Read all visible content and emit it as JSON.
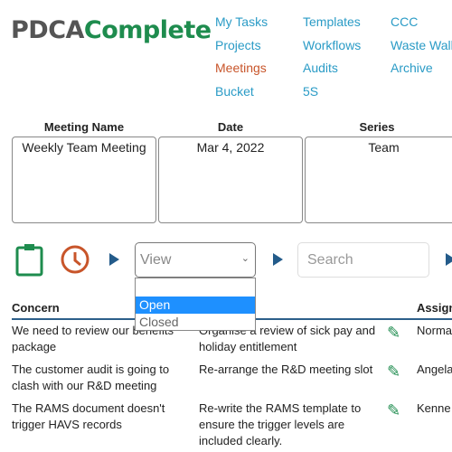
{
  "logo": {
    "part1": "PDCA",
    "part2": "Complete"
  },
  "nav": [
    {
      "label": "My Tasks"
    },
    {
      "label": "Projects"
    },
    {
      "label": "Meetings",
      "active": true
    },
    {
      "label": "Bucket"
    },
    {
      "label": "Templates"
    },
    {
      "label": "Workflows"
    },
    {
      "label": "Audits"
    },
    {
      "label": "5S"
    },
    {
      "label": "CCC"
    },
    {
      "label": "Waste Walk"
    },
    {
      "label": "Archive"
    }
  ],
  "meeting": {
    "name_header": "Meeting Name",
    "name": "Weekly Team Meeting",
    "date_header": "Date",
    "date": "Mar 4, 2022",
    "series_header": "Series",
    "series": "Team"
  },
  "toolbar": {
    "view_placeholder": "View",
    "search_placeholder": "Search",
    "view_options": [
      "",
      "Open",
      "Closed"
    ],
    "highlighted_option": "Open"
  },
  "table": {
    "headers": {
      "concern": "Concern",
      "assigned": "Assign"
    },
    "rows": [
      {
        "concern": "We need to review our benefits package",
        "action": "Organise a review of sick pay and holiday entitlement",
        "assignee": "Norma"
      },
      {
        "concern": "The customer audit is going to clash with our R&D meeting",
        "action": "Re-arrange the R&D meeting slot",
        "assignee": "Angela"
      },
      {
        "concern": "The RAMS document doesn't trigger HAVS records",
        "action": "Re-write the RAMS template to ensure the trigger levels are included clearly.",
        "assignee": "Kenne"
      }
    ]
  },
  "colors": {
    "brand_green": "#1e8c4e",
    "nav_link": "#2a9bc6",
    "active": "#c8552a",
    "accent": "#235b8a"
  }
}
